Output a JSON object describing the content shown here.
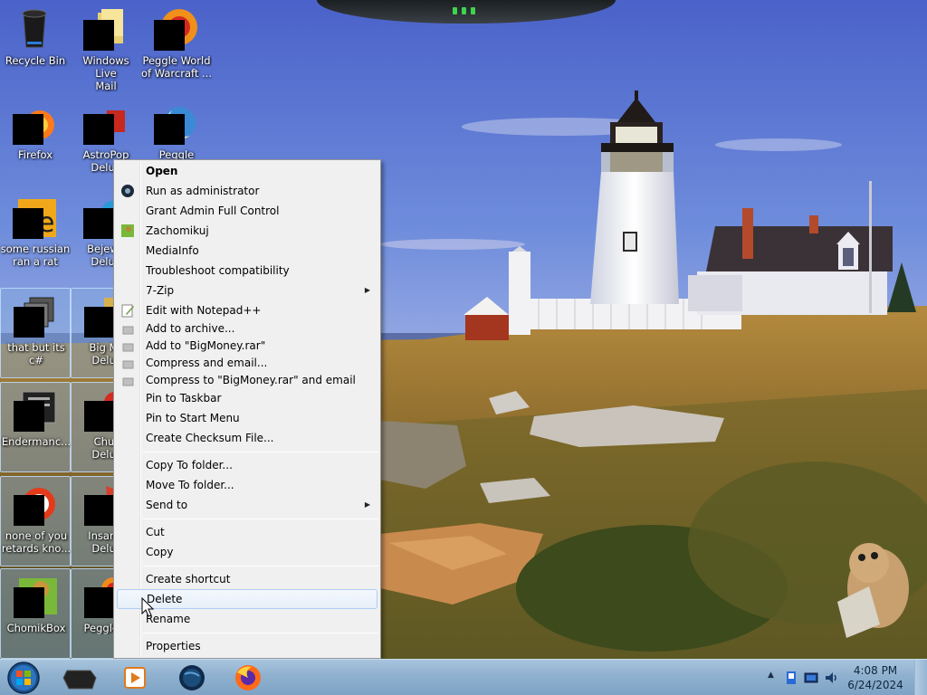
{
  "desktop": {
    "icons": [
      {
        "label": "Recycle Bin"
      },
      {
        "label": "Windows Live\nMail"
      },
      {
        "label": "Peggle World\nof Warcraft ..."
      },
      {
        "label": "Firefox"
      },
      {
        "label": "AstroPop\nDelux"
      },
      {
        "label": "Peggle Nights"
      },
      {
        "label": "some russian\nran a rat"
      },
      {
        "label": "Bejewe\nDelux"
      },
      {
        "label": "that but its c#"
      },
      {
        "label": "Big Mo\nDelux"
      },
      {
        "label": "Endermanc..."
      },
      {
        "label": "Chuz\nDelux"
      },
      {
        "label": "none of you\nretards kno..."
      },
      {
        "label": "Insaniq\nDelux"
      },
      {
        "label": "ChomikBox"
      },
      {
        "label": "Peggle D"
      }
    ]
  },
  "context_menu": {
    "items": {
      "open": "Open",
      "run_as_admin": "Run as administrator",
      "grant_admin": "Grant Admin Full Control",
      "zachomikuj": "Zachomikuj",
      "mediainfo": "MediaInfo",
      "troubleshoot": "Troubleshoot compatibility",
      "seven_zip": "7-Zip",
      "notepadpp": "Edit with Notepad++",
      "add_archive": "Add to archive...",
      "add_rar": "Add to \"BigMoney.rar\"",
      "compress_email": "Compress and email...",
      "compress_rar_email": "Compress to \"BigMoney.rar\" and email",
      "pin_taskbar": "Pin to Taskbar",
      "pin_start": "Pin to Start Menu",
      "checksum": "Create Checksum File...",
      "copy_to": "Copy To folder...",
      "move_to": "Move To folder...",
      "send_to": "Send to",
      "cut": "Cut",
      "copy": "Copy",
      "create_shortcut": "Create shortcut",
      "delete": "Delete",
      "rename": "Rename",
      "properties": "Properties"
    },
    "hovered": "delete"
  },
  "taskbar": {
    "clock": {
      "time": "4:08 PM",
      "date": "6/24/2024"
    }
  },
  "colors": {
    "menu_bg": "#f0f0f0",
    "menu_hover_border": "#aecff7",
    "taskbar": "#8fb1cf"
  }
}
